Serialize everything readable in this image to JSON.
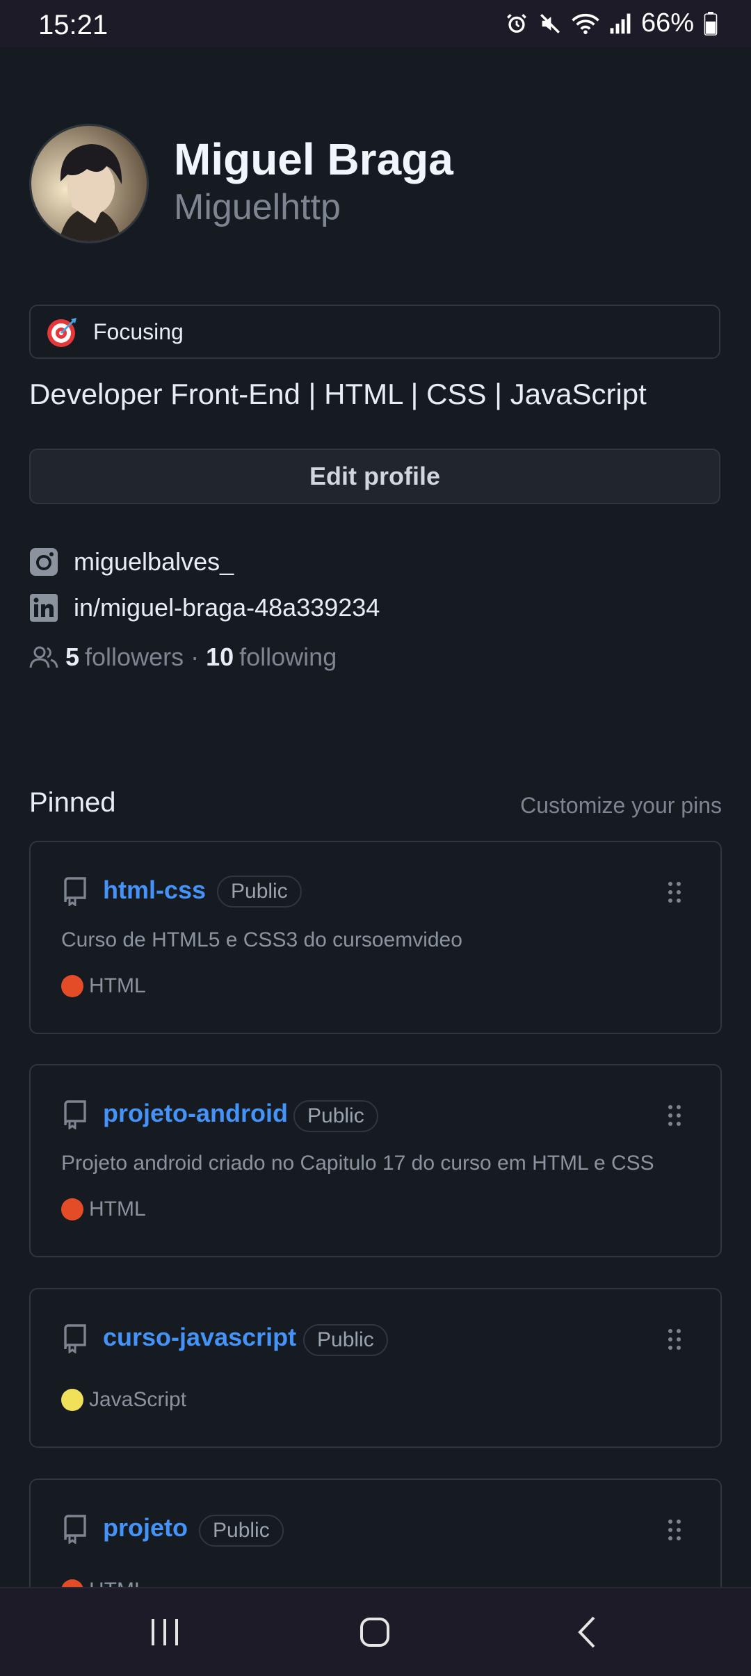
{
  "status_bar": {
    "time": "15:21",
    "battery": "66%"
  },
  "profile": {
    "name": "Miguel Braga",
    "login": "Miguelhttp",
    "status": "Focusing",
    "bio": "Developer Front-End | HTML | CSS | JavaScript",
    "edit_label": "Edit profile",
    "instagram": "miguelbalves_",
    "linkedin": "in/miguel-braga-48a339234",
    "followers_count": "5",
    "followers_label": "followers",
    "separator": "·",
    "following_count": "10",
    "following_label": "following"
  },
  "pinned": {
    "title": "Pinned",
    "customize_label": "Customize your pins",
    "repos": [
      {
        "name": "html-css",
        "visibility": "Public",
        "description": "Curso de HTML5 e CSS3 do cursoemvideo",
        "language": "HTML",
        "language_color": "#e34c26"
      },
      {
        "name": "projeto-android",
        "visibility": "Public",
        "description": "Projeto android criado no Capitulo 17 do curso em HTML e CSS",
        "language": "HTML",
        "language_color": "#e34c26"
      },
      {
        "name": "curso-javascript",
        "visibility": "Public",
        "description": "",
        "language": "JavaScript",
        "language_color": "#f1e05a"
      },
      {
        "name": "projeto",
        "visibility": "Public",
        "description": "",
        "language": "HTML",
        "language_color": "#e34c26"
      }
    ]
  },
  "colors": {
    "background": "#161b22",
    "link": "#4493f8",
    "muted": "#7d8590",
    "border": "#30363d"
  }
}
